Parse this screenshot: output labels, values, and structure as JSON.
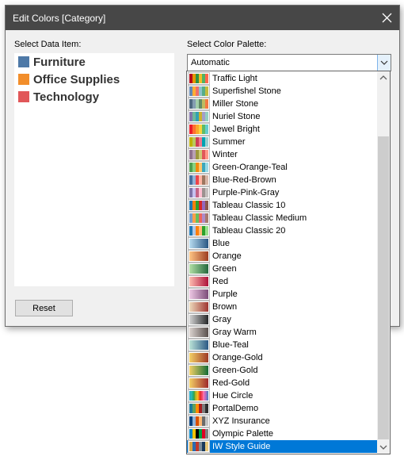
{
  "dialog": {
    "title": "Edit Colors [Category]",
    "select_data_label": "Select Data Item:",
    "select_palette_label": "Select Color Palette:",
    "reset_label": "Reset"
  },
  "data_items": [
    {
      "label": "Furniture",
      "color": "#4e79a7"
    },
    {
      "label": "Office Supplies",
      "color": "#f28e2b"
    },
    {
      "label": "Technology",
      "color": "#e15759"
    }
  ],
  "palette_select": {
    "value": "Automatic"
  },
  "palette_options": [
    {
      "label": "Traffic Light",
      "name": "traffic-light",
      "colors": [
        "#b60a1c",
        "#e39802",
        "#309143",
        "#f0bd27",
        "#51b364",
        "#ff684c"
      ]
    },
    {
      "label": "Superfishel Stone",
      "name": "superfishel-stone",
      "colors": [
        "#6388b4",
        "#ffae34",
        "#ef6f6a",
        "#8cc2ca",
        "#55ad89",
        "#c3bc3f"
      ]
    },
    {
      "label": "Miller Stone",
      "name": "miller-stone",
      "colors": [
        "#4f6980",
        "#849db1",
        "#a2ceaa",
        "#638b66",
        "#bfbb60",
        "#f47942"
      ]
    },
    {
      "label": "Nuriel Stone",
      "name": "nuriel-stone",
      "colors": [
        "#8175aa",
        "#6fb899",
        "#31a1b3",
        "#ccb22b",
        "#a39fc9",
        "#94d0c0"
      ]
    },
    {
      "label": "Jewel Bright",
      "name": "jewel-bright",
      "colors": [
        "#eb1e2c",
        "#fd6f30",
        "#f9a729",
        "#f9d23c",
        "#5fbb68",
        "#64cdcc"
      ]
    },
    {
      "label": "Summer",
      "name": "summer",
      "colors": [
        "#bfb202",
        "#b9ca5d",
        "#cf3e53",
        "#f1788d",
        "#00a2b3",
        "#97cfd0"
      ]
    },
    {
      "label": "Winter",
      "name": "winter",
      "colors": [
        "#90728f",
        "#b9a0b4",
        "#9d983d",
        "#cecb76",
        "#e15759",
        "#ff9888"
      ]
    },
    {
      "label": "Green-Orange-Teal",
      "name": "green-orange-teal",
      "colors": [
        "#4e9f50",
        "#87d180",
        "#ef8a0c",
        "#fcc66d",
        "#3ca8bc",
        "#98d9e4"
      ]
    },
    {
      "label": "Blue-Red-Brown",
      "name": "blue-red-brown",
      "colors": [
        "#466f9d",
        "#91b3d7",
        "#ed444a",
        "#feb5a2",
        "#9d7660",
        "#d7b5a6"
      ]
    },
    {
      "label": "Purple-Pink-Gray",
      "name": "purple-pink-gray",
      "colors": [
        "#8074a8",
        "#c6c1f0",
        "#c46487",
        "#ffbed1",
        "#9c9290",
        "#c5bfbe"
      ]
    },
    {
      "label": "Tableau Classic 10",
      "name": "tableau-classic-10",
      "colors": [
        "#1f77b4",
        "#ff7f0e",
        "#2ca02c",
        "#d62728",
        "#9467bd",
        "#8c564b"
      ]
    },
    {
      "label": "Tableau Classic Medium",
      "name": "tableau-classic-medium",
      "colors": [
        "#729ece",
        "#ff9e4a",
        "#67bf5c",
        "#ed665d",
        "#ad8bc9",
        "#a8786e"
      ]
    },
    {
      "label": "Tableau Classic 20",
      "name": "tableau-classic-20",
      "colors": [
        "#1f77b4",
        "#aec7e8",
        "#ff7f0e",
        "#ffbb78",
        "#2ca02c",
        "#98df8a"
      ]
    },
    {
      "label": "Blue",
      "name": "blue",
      "gradient": [
        "#b9ddf1",
        "#2a5783"
      ]
    },
    {
      "label": "Orange",
      "name": "orange",
      "gradient": [
        "#ffc685",
        "#9e3d22"
      ]
    },
    {
      "label": "Green",
      "name": "green",
      "gradient": [
        "#b3e0a6",
        "#24693d"
      ]
    },
    {
      "label": "Red",
      "name": "red",
      "gradient": [
        "#ffbeb2",
        "#ae123a"
      ]
    },
    {
      "label": "Purple",
      "name": "purple",
      "gradient": [
        "#eec9e5",
        "#7c4d79"
      ]
    },
    {
      "label": "Brown",
      "name": "brown",
      "gradient": [
        "#eedbbd",
        "#9f3632"
      ]
    },
    {
      "label": "Gray",
      "name": "gray",
      "gradient": [
        "#d5d5d5",
        "#26282a"
      ]
    },
    {
      "label": "Gray Warm",
      "name": "gray-warm",
      "gradient": [
        "#dcd4d0",
        "#59504e"
      ]
    },
    {
      "label": "Blue-Teal",
      "name": "blue-teal",
      "gradient": [
        "#bce4d8",
        "#2c5985"
      ]
    },
    {
      "label": "Orange-Gold",
      "name": "orange-gold",
      "gradient": [
        "#f4d166",
        "#9e3a26"
      ]
    },
    {
      "label": "Green-Gold",
      "name": "green-gold",
      "gradient": [
        "#f4d166",
        "#146c36"
      ]
    },
    {
      "label": "Red-Gold",
      "name": "red-gold",
      "gradient": [
        "#f4d166",
        "#9f2a2a"
      ]
    },
    {
      "label": "Hue Circle",
      "name": "hue-circle",
      "colors": [
        "#1ba3c6",
        "#2cb5c0",
        "#30bcad",
        "#21b087",
        "#33a65c",
        "#57a337",
        "#a2b627",
        "#d5bb21",
        "#f8b620",
        "#f89217",
        "#f06719",
        "#e03426",
        "#eb364a",
        "#f64971",
        "#fc719e",
        "#eb73b3",
        "#ce69be",
        "#a26dc2",
        "#7873c0",
        "#4f7cba"
      ]
    },
    {
      "label": "PortalDemo",
      "name": "portal-demo",
      "colors": [
        "#1d7a9b",
        "#5fa15d",
        "#ff8c00",
        "#a61e22",
        "#7d7d7d",
        "#2e2e2e"
      ]
    },
    {
      "label": "XYZ Insurance",
      "name": "xyz-insurance",
      "colors": [
        "#003f7d",
        "#8fb3d9",
        "#d94f00",
        "#f9b572",
        "#6b6b6b",
        "#c2c2c2"
      ]
    },
    {
      "label": "Olympic Palette",
      "name": "olympic-palette",
      "colors": [
        "#0085c7",
        "#f4c300",
        "#000000",
        "#009f3d",
        "#df0024",
        "#7f7f7f"
      ]
    },
    {
      "label": "IW Style Guide",
      "name": "iw-style-guide",
      "colors": [
        "#d9a441",
        "#2b6cb0",
        "#c0392b",
        "#7a8b99",
        "#1a3a5c",
        "#e8c77a"
      ]
    }
  ],
  "selected_option": "IW Style Guide",
  "colors": {
    "titlebar": "#474747",
    "dialog_bg": "#f0f0f0",
    "selection": "#0078d7",
    "scroll_thumb": "#cdcdcd"
  },
  "icons": {
    "close": "close-icon",
    "dropdown": "chevron-down-icon",
    "scroll_up": "scroll-up-arrow-icon",
    "scroll_down": "scroll-down-arrow-icon"
  }
}
